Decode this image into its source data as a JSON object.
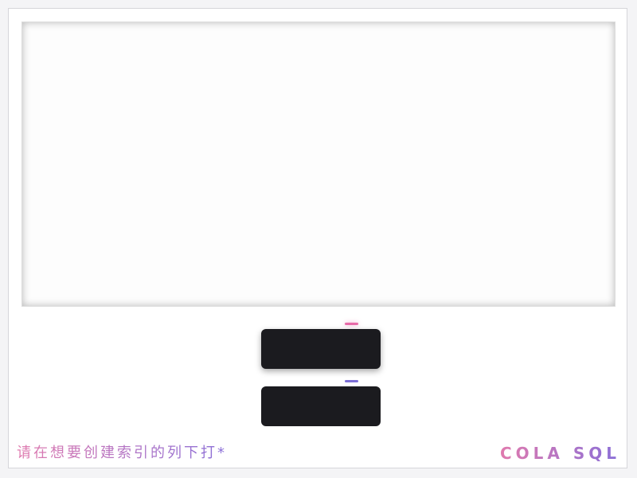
{
  "colors": {
    "accent_pink": "#e86aa8",
    "accent_purple": "#7c6fd6",
    "button_dark": "#1b1b1f",
    "gradient_start": "#e07aae",
    "gradient_end": "#8a6fd8"
  },
  "footer": {
    "hint": "请在想要创建索引的列下打*"
  },
  "brand": {
    "name": "COLA SQL"
  }
}
